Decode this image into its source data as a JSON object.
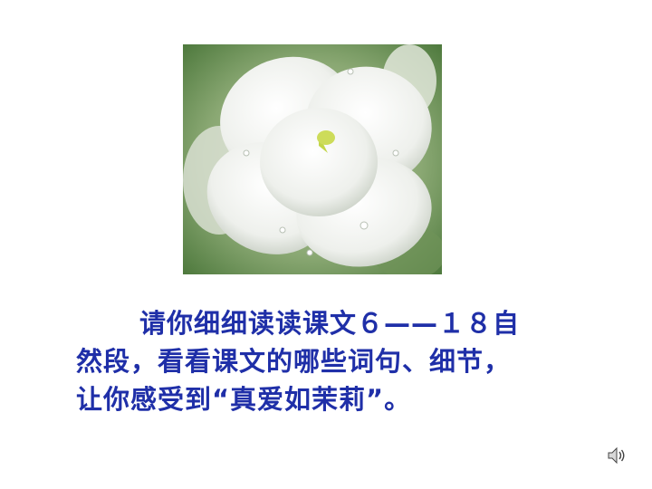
{
  "slide": {
    "image": {
      "alt": "jasmine flower with water drops",
      "icon": "jasmine-flower-photo"
    },
    "text_lines": [
      "请你细细读读课文６——１８自",
      "然段，看看课文的哪些词句、细节，",
      "让你感受到“真爱如茉莉”。"
    ],
    "text_color": "#1f2fa8",
    "audio_icon": "speaker-icon"
  }
}
